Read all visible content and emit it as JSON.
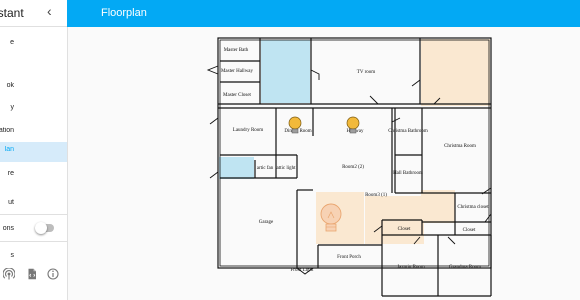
{
  "app": {
    "title": "istant"
  },
  "sidebar": {
    "items": [
      {
        "label": "e"
      },
      {
        "label": "ok"
      },
      {
        "label": "y"
      },
      {
        "label": "guration"
      },
      {
        "label": "lan",
        "active": true
      },
      {
        "label": "re"
      },
      {
        "label": "ut"
      },
      {
        "label": "ons"
      },
      {
        "label": "s"
      }
    ],
    "toggle_on": false,
    "footer_icons": [
      "broadcast-icon",
      "file-code-icon",
      "info-icon"
    ]
  },
  "header": {
    "title": "Floorplan"
  },
  "floorplan": {
    "rooms": [
      "Master Bath",
      "Master Hallway",
      "Master Closet",
      "TV room",
      "Laundry Room",
      "Dining Room",
      "Hallway",
      "Christma Bathroom",
      "Christma Room",
      "artic fan",
      "attic light",
      "Room2 (2)",
      "Hall Bathroom",
      "Christma closet",
      "Garage",
      "Room3 (1)",
      "Closet",
      "Closet",
      "Front Light",
      "Front Porch",
      "Jazmin Room",
      "Grandma Room"
    ]
  },
  "colors": {
    "accent": "#03a9f4",
    "light_blue": "#bfe4f2",
    "light_orange": "#fae8d1",
    "bulb_on": "#f2b93a",
    "bulb_off": "#f7d2b4"
  }
}
